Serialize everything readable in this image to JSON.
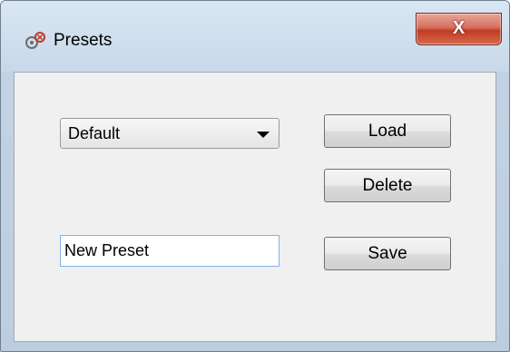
{
  "window": {
    "title": "Presets",
    "close_label": "X"
  },
  "preset_select": {
    "selected": "Default"
  },
  "buttons": {
    "load": "Load",
    "delete": "Delete",
    "save": "Save"
  },
  "name_input": {
    "value": "New Preset"
  },
  "icons": {
    "app": "presets-app-icon",
    "close": "close-icon",
    "dropdown": "chevron-down-icon"
  },
  "colors": {
    "titlebar": "#c8d8e9",
    "close_button": "#c13c24",
    "client": "#f0f0f0",
    "input_focus_border": "#7eb4ea"
  }
}
